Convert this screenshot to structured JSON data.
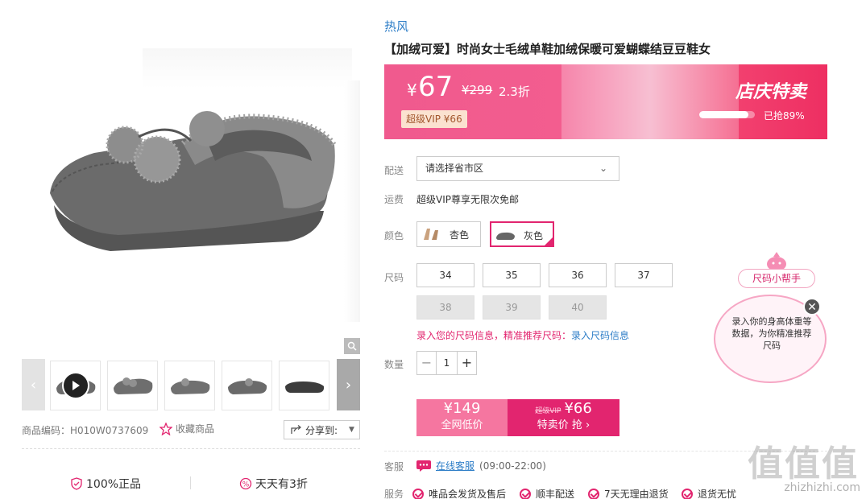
{
  "brand": "热风",
  "title": "【加绒可爱】时尚女士毛绒单鞋加绒保暖可爱蝴蝶结豆豆鞋女",
  "price_banner": {
    "currency": "¥",
    "price": "67",
    "original_price": "¥299",
    "discount": "2.3折",
    "vip_price": "超级VIP ¥66",
    "promo_title": "店庆特卖",
    "sold_label": "已抢89%",
    "sold_fraction": 0.89
  },
  "delivery": {
    "label": "配送",
    "select_value": "请选择省市区"
  },
  "shipping": {
    "label": "运费",
    "text": "超级VIP尊享无限次免邮"
  },
  "colors": {
    "label": "颜色",
    "options": [
      {
        "label": "杏色",
        "selected": false
      },
      {
        "label": "灰色",
        "selected": true
      }
    ]
  },
  "sizes": {
    "label": "尺码",
    "available": [
      "34",
      "35",
      "36",
      "37"
    ],
    "unavailable": [
      "38",
      "39",
      "40"
    ],
    "hint_red": "录入您的尺码信息，精准推荐尺码：",
    "hint_link": "录入尺码信息"
  },
  "quantity": {
    "label": "数量",
    "minus": "−",
    "value": "1",
    "plus": "+"
  },
  "buy": {
    "left_price": "¥149",
    "left_label": "全网低价",
    "right_vip_tag": "超级VIP",
    "right_price": "¥66",
    "right_label": "特卖价 抢 ›"
  },
  "customer_service": {
    "label": "客服",
    "link": "在线客服",
    "hours": "(09:00-22:00)"
  },
  "services": {
    "label": "服务",
    "items": [
      "唯品会发货及售后",
      "顺丰配送",
      "7天无理由退货",
      "退货无忧"
    ]
  },
  "product_code": "商品编码：H010W0737609",
  "favorite_label": "收藏商品",
  "share_label": "分享到:",
  "guarantees": [
    "100%正品",
    "天天有3折"
  ],
  "size_helper": {
    "chip": "尺码小帮手",
    "text": "录入你的身高体重等数据，为你精准推荐尺码",
    "close": "✕"
  },
  "watermark": {
    "big": "值值值",
    "small": "zhizhizhi.com"
  },
  "colors_theme": {
    "accent": "#e2256f",
    "link": "#2e7ec7",
    "banner": "#f05a8e"
  }
}
